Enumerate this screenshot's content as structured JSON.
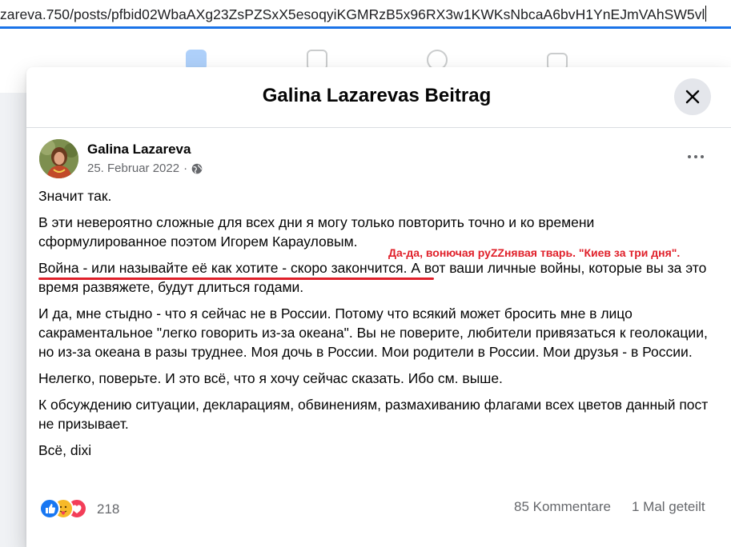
{
  "address_bar": {
    "url": "zareva.750/posts/pfbid02WbaAXg23ZsPZSxX5esoqyiKGMRzB5x96RX3w1KWKsNbcaA6bvH1YnEJmVAhSW5vl"
  },
  "modal": {
    "title": "Galina Lazarevas Beitrag"
  },
  "post": {
    "author": "Galina Lazareva",
    "date": "25. Februar 2022",
    "dot": "·",
    "paragraphs": [
      "Значит так.",
      "В эти невероятно сложные для всех дни я могу только повторить точно и ко времени сформулированное поэтом Игорем Карауловым.",
      "",
      "И да, мне стыдно - что я сейчас не в России. Потому что всякий может бросить мне в лицо сакраментальное \"легко говорить из-за океана\". Вы не поверите, любители привязаться к геолокации, но из-за океана в разы труднее. Моя дочь в России. Мои родители в России. Мои друзья - в России.",
      "Нелегко, поверьте. И это всё, что я хочу сейчас сказать. Ибо см. выше.",
      "К обсуждению ситуации, декларациям, обвинениям, размахиванию флагами всех цветов данный пост не призывает.",
      "Всё, dixi"
    ],
    "war_highlight": "Война - или называйте её как хотите - скоро закончится.",
    "war_rest": " А вот ваши личные войны, которые вы за это время развяжете, будут длиться годами.",
    "annotation": "Да-да, вонючая руZZнявая тварь. \"Киев за три дня\"."
  },
  "footer": {
    "reaction_count": "218",
    "comments": "85 Kommentare",
    "shares": "1 Mal geteilt"
  },
  "colors": {
    "accent_blue": "#1a73e8",
    "annotation_red": "#e0202a",
    "like_blue": "#1877f2",
    "care_yellow": "#f7b928",
    "love_red": "#f33e58"
  }
}
